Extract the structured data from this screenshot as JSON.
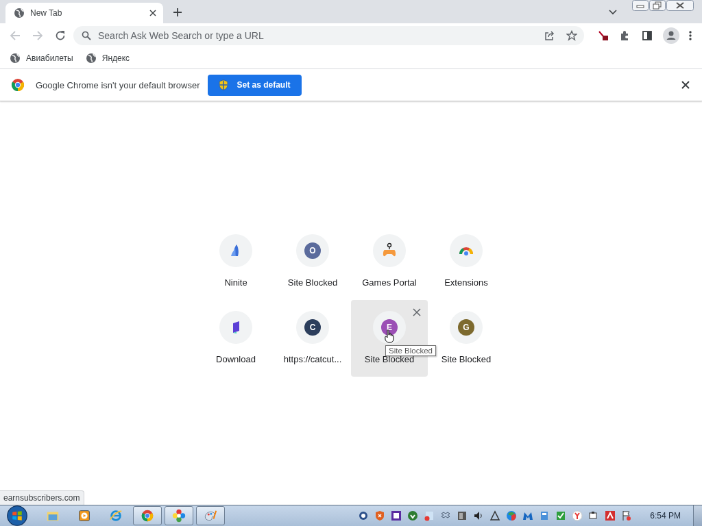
{
  "tab_strip": {
    "tabs": [
      {
        "title": "New Tab",
        "selected": true
      }
    ]
  },
  "toolbar": {
    "back": {
      "disabled": true
    },
    "forward": {
      "disabled": true
    },
    "omnibox": {
      "placeholder": "Search Ask Web Search or type a URL"
    }
  },
  "bookmarks": [
    {
      "label": "Авиабилеты"
    },
    {
      "label": "Яндекс"
    }
  ],
  "infobar": {
    "message": "Google Chrome isn't your default browser",
    "button": "Set as default"
  },
  "shortcuts": [
    {
      "title": "Ninite",
      "kind": "ninite",
      "hovered": false
    },
    {
      "title": "Site Blocked",
      "kind": "letter",
      "letter": "O",
      "color": "#5b6b9c",
      "hovered": false
    },
    {
      "title": "Games Portal",
      "kind": "games",
      "hovered": false
    },
    {
      "title": "Extensions",
      "kind": "extensions",
      "hovered": false
    },
    {
      "title": "Download",
      "kind": "download",
      "hovered": false
    },
    {
      "title": "https://catcut...",
      "kind": "letter",
      "letter": "C",
      "color": "#2c3e5c",
      "hovered": false
    },
    {
      "title": "Site Blocked",
      "kind": "letter",
      "letter": "E",
      "color": "#9b4fb5",
      "hovered": true
    },
    {
      "title": "Site Blocked",
      "kind": "letter",
      "letter": "G",
      "color": "#7d6a2e",
      "hovered": false
    }
  ],
  "tooltip": "Site Blocked",
  "status_bubble": "earnsubscribers.com",
  "taskbar": {
    "apps": [
      {
        "kind": "explorer",
        "running": false
      },
      {
        "kind": "media",
        "running": false
      },
      {
        "kind": "ie",
        "running": false
      },
      {
        "kind": "chrome",
        "running": true
      },
      {
        "kind": "pinwheel",
        "running": true
      },
      {
        "kind": "paint",
        "running": true
      }
    ],
    "clock": "6:54 PM"
  }
}
